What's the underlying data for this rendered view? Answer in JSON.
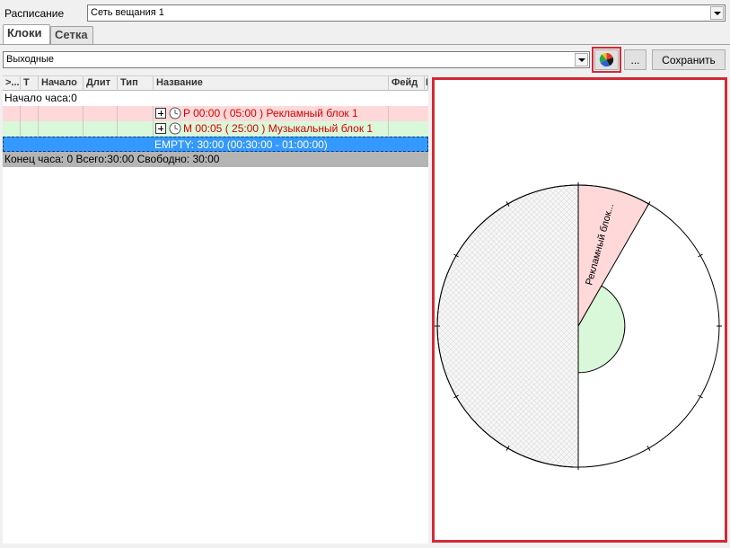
{
  "schedule": {
    "label": "Расписание",
    "value": "Сеть вещания 1"
  },
  "tabs": [
    {
      "label": "Клоки",
      "active": true
    },
    {
      "label": "Сетка",
      "active": false
    }
  ],
  "clock_select": {
    "value": "Выходные"
  },
  "toolbar": {
    "ellipsis_label": "...",
    "save_label": "Сохранить",
    "chart_icon": "pie-chart-icon"
  },
  "grid": {
    "columns": [
      ">...",
      "Т",
      "Начало",
      "Длит",
      "Тип",
      "Название",
      "Фейд",
      "I"
    ],
    "hour_start": "Начало часа:0",
    "rows": [
      {
        "code": "P",
        "text": "P 00:00 ( 05:00 ) Рекламный блок 1",
        "color": "#ffd9d9"
      },
      {
        "code": "M",
        "text": "M 00:05 ( 25:00 ) Музыкальный блок 1",
        "color": "#d9f7d9"
      }
    ],
    "empty_row": "EMPTY: 30:00 (00:30:00 - 01:00:00)",
    "hour_end": "Конец часа: 0 Всего:30:00 Свободно: 30:00"
  },
  "chart_data": {
    "type": "pie",
    "total_minutes": 60,
    "segments": [
      {
        "label": "Рекламный блок...",
        "start_min": 0,
        "duration_min": 5,
        "radius_fraction": 1.0,
        "color": "#ffd9d9"
      },
      {
        "label": "",
        "start_min": 5,
        "duration_min": 25,
        "radius_fraction": 0.33,
        "color": "#d9f7d9"
      },
      {
        "label": "",
        "start_min": 30,
        "duration_min": 30,
        "radius_fraction": 1.0,
        "color": "#f2f2f2",
        "hatched": true
      }
    ],
    "ticks": 12
  }
}
